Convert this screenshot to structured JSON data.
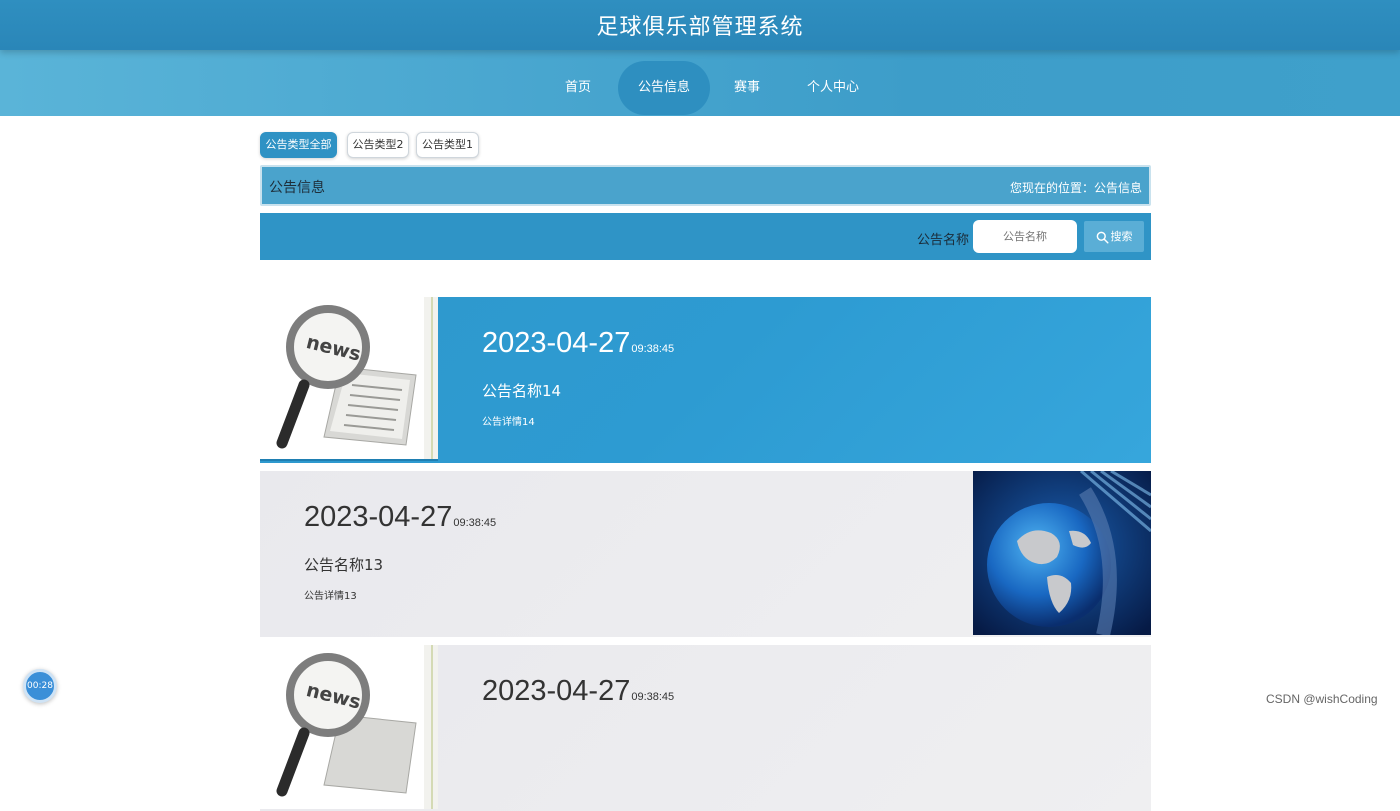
{
  "header": {
    "title": "足球俱乐部管理系统"
  },
  "nav": {
    "items": [
      {
        "label": "首页"
      },
      {
        "label": "公告信息"
      },
      {
        "label": "赛事"
      },
      {
        "label": "个人中心"
      }
    ],
    "active": "公告信息"
  },
  "filter": {
    "types": [
      {
        "label": "公告类型全部"
      },
      {
        "label": "公告类型2"
      },
      {
        "label": "公告类型1"
      }
    ],
    "active": "公告类型全部"
  },
  "breadcrumb": {
    "title": "公告信息",
    "location": "您现在的位置：公告信息"
  },
  "search": {
    "label": "公告名称",
    "placeholder": "公告名称",
    "button": "搜索"
  },
  "notices": [
    {
      "date": "2023-04-27",
      "time": "09:38:45",
      "name": "公告名称14",
      "detail": "公告详情14"
    },
    {
      "date": "2023-04-27",
      "time": "09:38:45",
      "name": "公告名称13",
      "detail": "公告详情13"
    },
    {
      "date": "2023-04-27",
      "time": "09:38:45",
      "name": "",
      "detail": ""
    }
  ],
  "icons": {
    "thumb1": "news-magnifier-icon",
    "thumb2": "globe-news-icon",
    "search": "search-icon"
  },
  "colors": {
    "primary": "#2f94c6",
    "nav": "#4aa7d0",
    "card_active": "#2d9bd2",
    "card_idle": "#ededf0"
  },
  "timer": {
    "text": "00:28"
  },
  "watermark": {
    "text": "CSDN @wishCoding"
  }
}
